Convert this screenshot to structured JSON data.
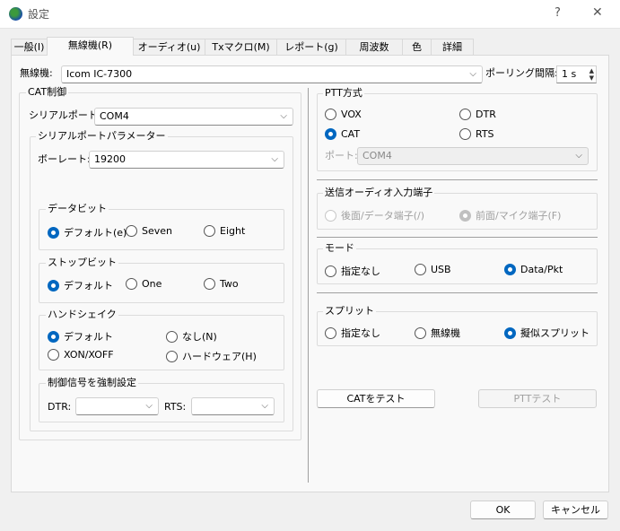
{
  "window": {
    "title": "設定",
    "help": "?",
    "close": "✕"
  },
  "tabs": [
    "一般(I)",
    "無線機(R)",
    "オーディオ(u)",
    "Txマクロ(M)",
    "レポート(g)",
    "周波数",
    "色",
    "詳細"
  ],
  "rig": {
    "label": "無線機:",
    "value": "Icom IC-7300",
    "polling_label": "ポーリング間隔:",
    "polling_value": "1 s"
  },
  "cat": {
    "title": "CAT制御",
    "serial_label": "シリアルポート:",
    "serial_value": "COM4",
    "params_title": "シリアルポートパラメーター",
    "baud_label": "ボーレート:",
    "baud_value": "19200",
    "databits": {
      "title": "データビット",
      "options": [
        "デフォルト(e)",
        "Seven",
        "Eight"
      ]
    },
    "stopbits": {
      "title": "ストップビット",
      "options": [
        "デフォルト",
        "One",
        "Two"
      ]
    },
    "handshake": {
      "title": "ハンドシェイク",
      "options": [
        "デフォルト",
        "なし(N)",
        "XON/XOFF",
        "ハードウェア(H)"
      ]
    },
    "force": {
      "title": "制御信号を強制設定",
      "dtr_label": "DTR:",
      "rts_label": "RTS:",
      "dtr_value": "",
      "rts_value": ""
    }
  },
  "ptt": {
    "title": "PTT方式",
    "options": [
      "VOX",
      "DTR",
      "CAT",
      "RTS"
    ],
    "port_label": "ポート:",
    "port_value": "COM4"
  },
  "txaudio": {
    "title": "送信オーディオ入力端子",
    "options": [
      "後面/データ端子(/)",
      "前面/マイク端子(F)"
    ]
  },
  "mode": {
    "title": "モード",
    "options": [
      "指定なし",
      "USB",
      "Data/Pkt"
    ]
  },
  "split": {
    "title": "スプリット",
    "options": [
      "指定なし",
      "無線機",
      "擬似スプリット"
    ]
  },
  "buttons": {
    "test_cat": "CATをテスト",
    "test_ptt": "PTTテスト",
    "ok": "OK",
    "cancel": "キャンセル"
  },
  "colors": {
    "accent": "#0067c0"
  }
}
